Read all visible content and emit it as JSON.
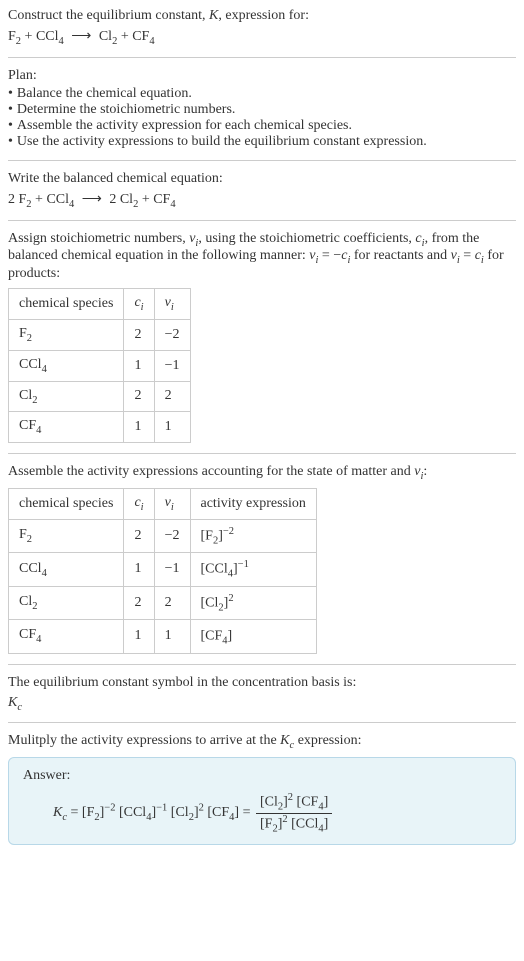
{
  "intro": {
    "line1": "Construct the equilibrium constant, ",
    "K": "K",
    "line1b": ", expression for:",
    "equation_lhs": "F",
    "equation_sub1": "2",
    "plus1": " + CCl",
    "equation_sub2": "4",
    "arrow": " ⟶ ",
    "equation_rhs": "Cl",
    "equation_sub3": "2",
    "plus2": " + CF",
    "equation_sub4": "4"
  },
  "plan": {
    "title": "Plan:",
    "items": [
      "Balance the chemical equation.",
      "Determine the stoichiometric numbers.",
      "Assemble the activity expression for each chemical species.",
      "Use the activity expressions to build the equilibrium constant expression."
    ]
  },
  "balanced": {
    "title": "Write the balanced chemical equation:",
    "c1": "2 F",
    "s1": "2",
    "c2": " + CCl",
    "s2": "4",
    "arrow": " ⟶ ",
    "c3": "2 Cl",
    "s3": "2",
    "c4": " + CF",
    "s4": "4"
  },
  "stoich": {
    "text1": "Assign stoichiometric numbers, ",
    "nu": "ν",
    "sub_i": "i",
    "text2": ", using the stoichiometric coefficients, ",
    "c": "c",
    "text3": ", from the balanced chemical equation in the following manner: ",
    "eq1a": "ν",
    "eq1b": " = −",
    "eq1c": "c",
    "text4": " for reactants and ",
    "eq2a": "ν",
    "eq2b": " = ",
    "eq2c": "c",
    "text5": " for products:"
  },
  "table1": {
    "headers": {
      "species": "chemical species",
      "ci": "c",
      "ci_sub": "i",
      "nui": "ν",
      "nui_sub": "i"
    },
    "rows": [
      {
        "species_a": "F",
        "species_sub": "2",
        "ci": "2",
        "nui": "−2"
      },
      {
        "species_a": "CCl",
        "species_sub": "4",
        "ci": "1",
        "nui": "−1"
      },
      {
        "species_a": "Cl",
        "species_sub": "2",
        "ci": "2",
        "nui": "2"
      },
      {
        "species_a": "CF",
        "species_sub": "4",
        "ci": "1",
        "nui": "1"
      }
    ]
  },
  "activity": {
    "text1": "Assemble the activity expressions accounting for the state of matter and ",
    "nu": "ν",
    "sub_i": "i",
    "text2": ":"
  },
  "table2": {
    "headers": {
      "species": "chemical species",
      "ci": "c",
      "ci_sub": "i",
      "nui": "ν",
      "nui_sub": "i",
      "activity": "activity expression"
    },
    "rows": [
      {
        "sp_a": "F",
        "sp_sub": "2",
        "ci": "2",
        "nui": "−2",
        "act_a": "[F",
        "act_sub": "2",
        "act_b": "]",
        "act_sup": "−2"
      },
      {
        "sp_a": "CCl",
        "sp_sub": "4",
        "ci": "1",
        "nui": "−1",
        "act_a": "[CCl",
        "act_sub": "4",
        "act_b": "]",
        "act_sup": "−1"
      },
      {
        "sp_a": "Cl",
        "sp_sub": "2",
        "ci": "2",
        "nui": "2",
        "act_a": "[Cl",
        "act_sub": "2",
        "act_b": "]",
        "act_sup": "2"
      },
      {
        "sp_a": "CF",
        "sp_sub": "4",
        "ci": "1",
        "nui": "1",
        "act_a": "[CF",
        "act_sub": "4",
        "act_b": "]",
        "act_sup": ""
      }
    ]
  },
  "kc_symbol": {
    "text": "The equilibrium constant symbol in the concentration basis is:",
    "K": "K",
    "sub": "c"
  },
  "multiply": {
    "text1": "Mulitply the activity expressions to arrive at the ",
    "K": "K",
    "sub": "c",
    "text2": " expression:"
  },
  "answer": {
    "label": "Answer:",
    "K": "K",
    "K_sub": "c",
    "eq": " = ",
    "t1": "[F",
    "t1s": "2",
    "t1b": "]",
    "t1sup": "−2",
    "t2": " [CCl",
    "t2s": "4",
    "t2b": "]",
    "t2sup": "−1",
    "t3": " [Cl",
    "t3s": "2",
    "t3b": "]",
    "t3sup": "2",
    "t4": " [CF",
    "t4s": "4",
    "t4b": "]",
    "eq2": " = ",
    "num1": "[Cl",
    "num1s": "2",
    "num1b": "]",
    "num1sup": "2",
    "num2": " [CF",
    "num2s": "4",
    "num2b": "]",
    "den1": "[F",
    "den1s": "2",
    "den1b": "]",
    "den1sup": "2",
    "den2": " [CCl",
    "den2s": "4",
    "den2b": "]"
  }
}
